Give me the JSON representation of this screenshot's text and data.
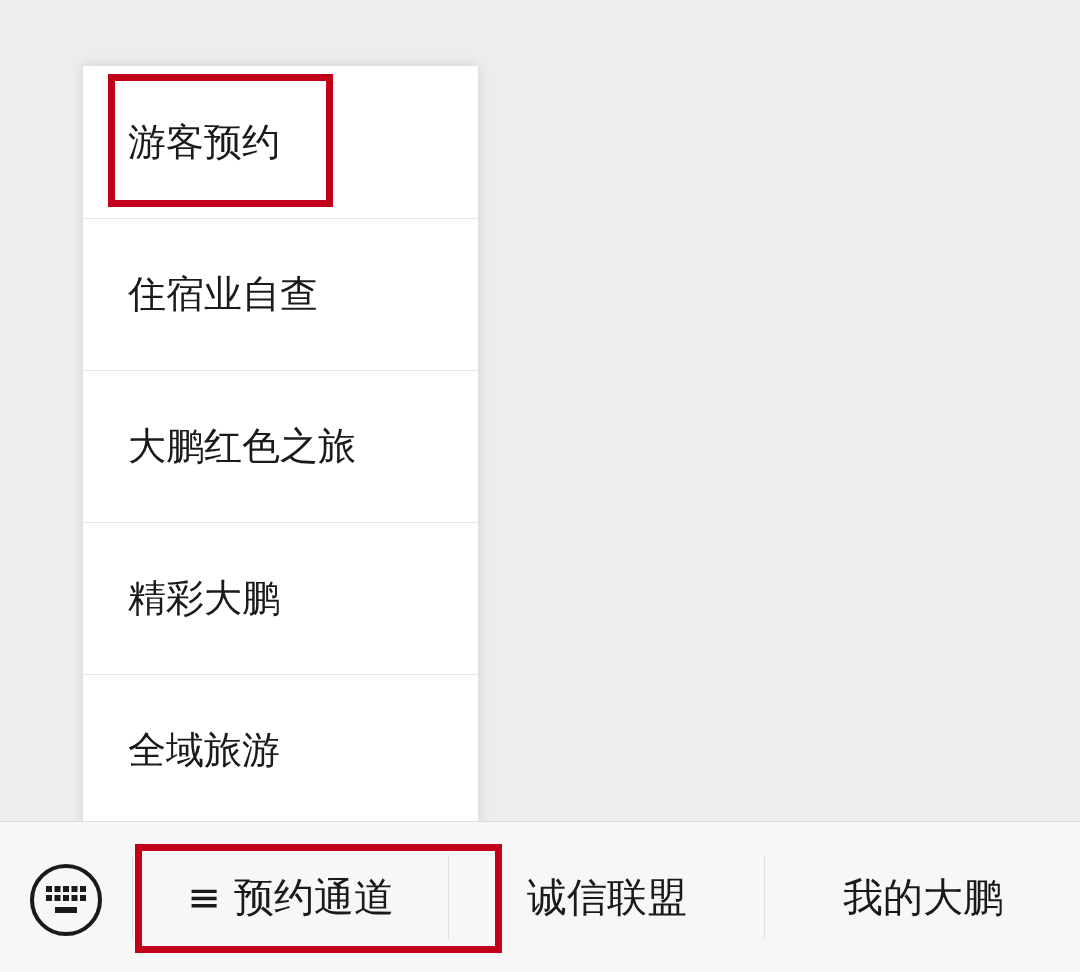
{
  "menu": {
    "items": [
      {
        "label": "游客预约",
        "highlighted": true
      },
      {
        "label": "住宿业自查",
        "highlighted": false
      },
      {
        "label": "大鹏红色之旅",
        "highlighted": false
      },
      {
        "label": "精彩大鹏",
        "highlighted": false
      },
      {
        "label": "全域旅游",
        "highlighted": false
      }
    ]
  },
  "bottom_bar": {
    "tabs": [
      {
        "label": "≡ 预约通道",
        "highlighted": true
      },
      {
        "label": "诚信联盟",
        "highlighted": false
      },
      {
        "label": "我的大鹏",
        "highlighted": false
      }
    ]
  }
}
